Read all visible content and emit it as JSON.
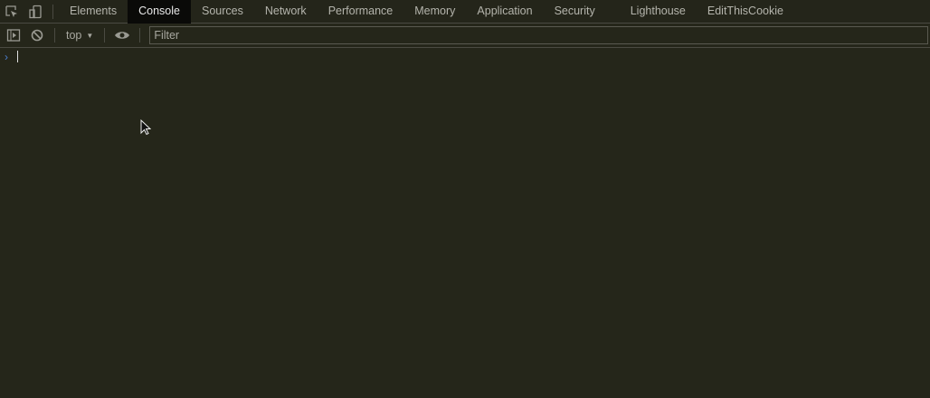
{
  "tabs": [
    {
      "label": "Elements"
    },
    {
      "label": "Console",
      "active": true
    },
    {
      "label": "Sources"
    },
    {
      "label": "Network"
    },
    {
      "label": "Performance"
    },
    {
      "label": "Memory"
    },
    {
      "label": "Application"
    },
    {
      "label": "Security"
    },
    {
      "label": "Lighthouse"
    },
    {
      "label": "EditThisCookie"
    }
  ],
  "toolbar": {
    "context": "top",
    "filter_placeholder": "Filter"
  },
  "console": {
    "prompt": "›"
  }
}
